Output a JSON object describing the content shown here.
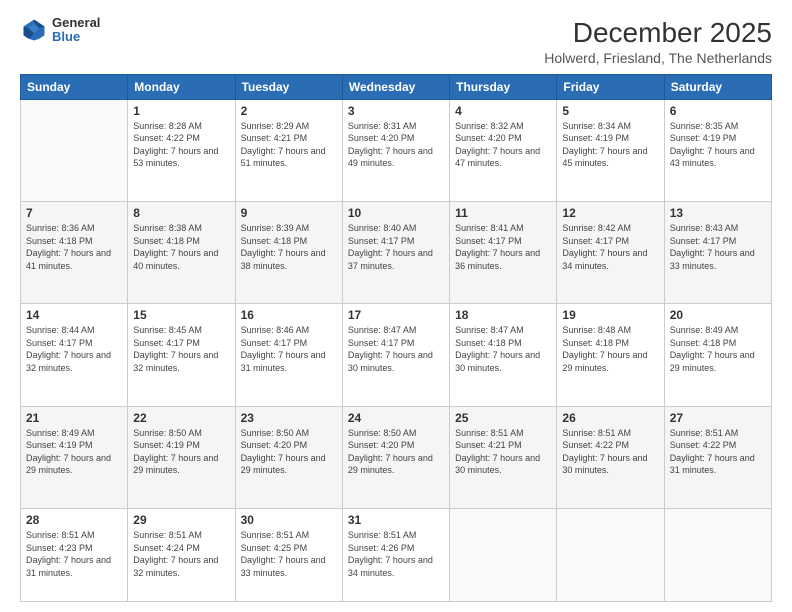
{
  "logo": {
    "general": "General",
    "blue": "Blue"
  },
  "title": "December 2025",
  "subtitle": "Holwerd, Friesland, The Netherlands",
  "days_of_week": [
    "Sunday",
    "Monday",
    "Tuesday",
    "Wednesday",
    "Thursday",
    "Friday",
    "Saturday"
  ],
  "weeks": [
    [
      {
        "day": "",
        "sunrise": "",
        "sunset": "",
        "daylight": ""
      },
      {
        "day": "1",
        "sunrise": "Sunrise: 8:28 AM",
        "sunset": "Sunset: 4:22 PM",
        "daylight": "Daylight: 7 hours and 53 minutes."
      },
      {
        "day": "2",
        "sunrise": "Sunrise: 8:29 AM",
        "sunset": "Sunset: 4:21 PM",
        "daylight": "Daylight: 7 hours and 51 minutes."
      },
      {
        "day": "3",
        "sunrise": "Sunrise: 8:31 AM",
        "sunset": "Sunset: 4:20 PM",
        "daylight": "Daylight: 7 hours and 49 minutes."
      },
      {
        "day": "4",
        "sunrise": "Sunrise: 8:32 AM",
        "sunset": "Sunset: 4:20 PM",
        "daylight": "Daylight: 7 hours and 47 minutes."
      },
      {
        "day": "5",
        "sunrise": "Sunrise: 8:34 AM",
        "sunset": "Sunset: 4:19 PM",
        "daylight": "Daylight: 7 hours and 45 minutes."
      },
      {
        "day": "6",
        "sunrise": "Sunrise: 8:35 AM",
        "sunset": "Sunset: 4:19 PM",
        "daylight": "Daylight: 7 hours and 43 minutes."
      }
    ],
    [
      {
        "day": "7",
        "sunrise": "Sunrise: 8:36 AM",
        "sunset": "Sunset: 4:18 PM",
        "daylight": "Daylight: 7 hours and 41 minutes."
      },
      {
        "day": "8",
        "sunrise": "Sunrise: 8:38 AM",
        "sunset": "Sunset: 4:18 PM",
        "daylight": "Daylight: 7 hours and 40 minutes."
      },
      {
        "day": "9",
        "sunrise": "Sunrise: 8:39 AM",
        "sunset": "Sunset: 4:18 PM",
        "daylight": "Daylight: 7 hours and 38 minutes."
      },
      {
        "day": "10",
        "sunrise": "Sunrise: 8:40 AM",
        "sunset": "Sunset: 4:17 PM",
        "daylight": "Daylight: 7 hours and 37 minutes."
      },
      {
        "day": "11",
        "sunrise": "Sunrise: 8:41 AM",
        "sunset": "Sunset: 4:17 PM",
        "daylight": "Daylight: 7 hours and 36 minutes."
      },
      {
        "day": "12",
        "sunrise": "Sunrise: 8:42 AM",
        "sunset": "Sunset: 4:17 PM",
        "daylight": "Daylight: 7 hours and 34 minutes."
      },
      {
        "day": "13",
        "sunrise": "Sunrise: 8:43 AM",
        "sunset": "Sunset: 4:17 PM",
        "daylight": "Daylight: 7 hours and 33 minutes."
      }
    ],
    [
      {
        "day": "14",
        "sunrise": "Sunrise: 8:44 AM",
        "sunset": "Sunset: 4:17 PM",
        "daylight": "Daylight: 7 hours and 32 minutes."
      },
      {
        "day": "15",
        "sunrise": "Sunrise: 8:45 AM",
        "sunset": "Sunset: 4:17 PM",
        "daylight": "Daylight: 7 hours and 32 minutes."
      },
      {
        "day": "16",
        "sunrise": "Sunrise: 8:46 AM",
        "sunset": "Sunset: 4:17 PM",
        "daylight": "Daylight: 7 hours and 31 minutes."
      },
      {
        "day": "17",
        "sunrise": "Sunrise: 8:47 AM",
        "sunset": "Sunset: 4:17 PM",
        "daylight": "Daylight: 7 hours and 30 minutes."
      },
      {
        "day": "18",
        "sunrise": "Sunrise: 8:47 AM",
        "sunset": "Sunset: 4:18 PM",
        "daylight": "Daylight: 7 hours and 30 minutes."
      },
      {
        "day": "19",
        "sunrise": "Sunrise: 8:48 AM",
        "sunset": "Sunset: 4:18 PM",
        "daylight": "Daylight: 7 hours and 29 minutes."
      },
      {
        "day": "20",
        "sunrise": "Sunrise: 8:49 AM",
        "sunset": "Sunset: 4:18 PM",
        "daylight": "Daylight: 7 hours and 29 minutes."
      }
    ],
    [
      {
        "day": "21",
        "sunrise": "Sunrise: 8:49 AM",
        "sunset": "Sunset: 4:19 PM",
        "daylight": "Daylight: 7 hours and 29 minutes."
      },
      {
        "day": "22",
        "sunrise": "Sunrise: 8:50 AM",
        "sunset": "Sunset: 4:19 PM",
        "daylight": "Daylight: 7 hours and 29 minutes."
      },
      {
        "day": "23",
        "sunrise": "Sunrise: 8:50 AM",
        "sunset": "Sunset: 4:20 PM",
        "daylight": "Daylight: 7 hours and 29 minutes."
      },
      {
        "day": "24",
        "sunrise": "Sunrise: 8:50 AM",
        "sunset": "Sunset: 4:20 PM",
        "daylight": "Daylight: 7 hours and 29 minutes."
      },
      {
        "day": "25",
        "sunrise": "Sunrise: 8:51 AM",
        "sunset": "Sunset: 4:21 PM",
        "daylight": "Daylight: 7 hours and 30 minutes."
      },
      {
        "day": "26",
        "sunrise": "Sunrise: 8:51 AM",
        "sunset": "Sunset: 4:22 PM",
        "daylight": "Daylight: 7 hours and 30 minutes."
      },
      {
        "day": "27",
        "sunrise": "Sunrise: 8:51 AM",
        "sunset": "Sunset: 4:22 PM",
        "daylight": "Daylight: 7 hours and 31 minutes."
      }
    ],
    [
      {
        "day": "28",
        "sunrise": "Sunrise: 8:51 AM",
        "sunset": "Sunset: 4:23 PM",
        "daylight": "Daylight: 7 hours and 31 minutes."
      },
      {
        "day": "29",
        "sunrise": "Sunrise: 8:51 AM",
        "sunset": "Sunset: 4:24 PM",
        "daylight": "Daylight: 7 hours and 32 minutes."
      },
      {
        "day": "30",
        "sunrise": "Sunrise: 8:51 AM",
        "sunset": "Sunset: 4:25 PM",
        "daylight": "Daylight: 7 hours and 33 minutes."
      },
      {
        "day": "31",
        "sunrise": "Sunrise: 8:51 AM",
        "sunset": "Sunset: 4:26 PM",
        "daylight": "Daylight: 7 hours and 34 minutes."
      },
      {
        "day": "",
        "sunrise": "",
        "sunset": "",
        "daylight": ""
      },
      {
        "day": "",
        "sunrise": "",
        "sunset": "",
        "daylight": ""
      },
      {
        "day": "",
        "sunrise": "",
        "sunset": "",
        "daylight": ""
      }
    ]
  ]
}
